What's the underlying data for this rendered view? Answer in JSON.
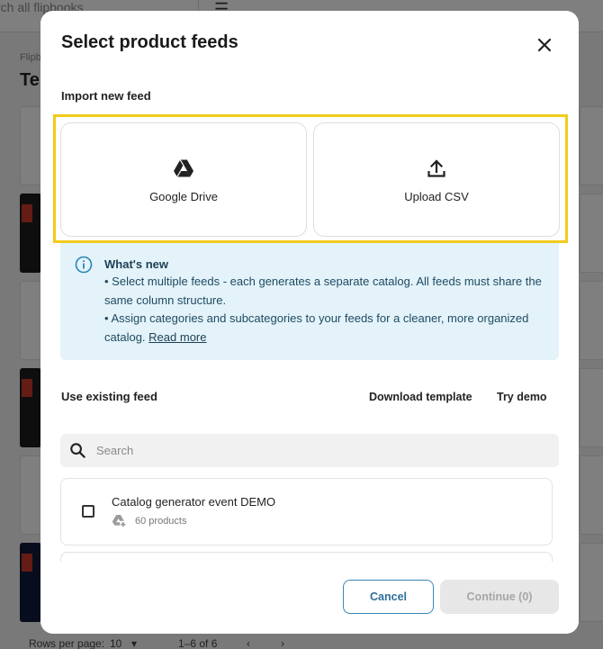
{
  "background": {
    "search_placeholder": "rch all flipbooks",
    "breadcrumb": "Flipb",
    "title": "Te",
    "footer": {
      "rows_per_page_label": "Rows per page:",
      "rows_per_page_value": "10",
      "range": "1–6 of 6"
    }
  },
  "modal": {
    "title": "Select product feeds",
    "close_icon": "close-icon",
    "import_section_label": "Import new feed",
    "import_options": [
      {
        "label": "Google Drive",
        "icon": "google-drive-icon"
      },
      {
        "label": "Upload CSV",
        "icon": "upload-icon"
      }
    ],
    "whats_new": {
      "icon": "info-icon",
      "title": "What's new",
      "lines": [
        "• Select multiple feeds - each generates a separate catalog. All feeds must share the",
        "same column structure.",
        "• Assign categories and subcategories to your feeds for a cleaner, more organized",
        "catalog."
      ],
      "read_more": "Read more"
    },
    "existing_section_label": "Use existing feed",
    "download_template_label": "Download template",
    "try_demo_label": "Try demo",
    "search": {
      "placeholder": "Search",
      "value": ""
    },
    "feeds": [
      {
        "name": "Catalog generator event DEMO",
        "count": "60 products",
        "checked": false,
        "source_icon": "google-drive-add-icon"
      }
    ],
    "buttons": {
      "cancel": "Cancel",
      "continue": "Continue (0)"
    }
  },
  "colors": {
    "highlight": "#f2cb1b",
    "info_bg": "#e3f3f9",
    "accent": "#2d6f99",
    "disabled_bg": "#e7e7e7"
  }
}
